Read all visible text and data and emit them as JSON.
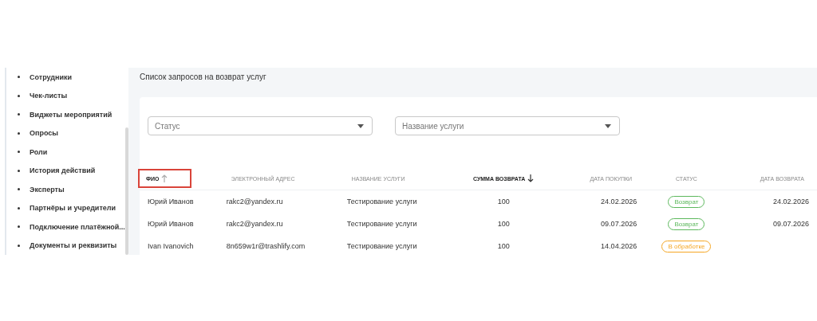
{
  "sidebar": {
    "items": [
      {
        "label": "Сотрудники"
      },
      {
        "label": "Чек-листы"
      },
      {
        "label": "Виджеты мероприятий"
      },
      {
        "label": "Опросы"
      },
      {
        "label": "Роли"
      },
      {
        "label": "История действий"
      },
      {
        "label": "Эксперты"
      },
      {
        "label": "Партнёры и учредители"
      },
      {
        "label": "Подключение платёжной..."
      },
      {
        "label": "Документы и реквизиты"
      }
    ]
  },
  "page_title": "Список запросов на возврат услуг",
  "filters": [
    {
      "placeholder": "Статус"
    },
    {
      "placeholder": "Название услуги"
    }
  ],
  "table": {
    "columns": [
      {
        "label": "ФИО",
        "sorted_ascending": true,
        "sorted_descending": false,
        "highlighted": true
      },
      {
        "label": "ЭЛЕКТРОННЫЙ АДРЕС",
        "sorted_ascending": false,
        "sorted_descending": false,
        "highlighted": false
      },
      {
        "label": "НАЗВАНИЕ УСЛУГИ",
        "sorted_ascending": false,
        "sorted_descending": false,
        "highlighted": false
      },
      {
        "label": "СУММА ВОЗВРАТА",
        "sorted_ascending": false,
        "sorted_descending": true,
        "highlighted": false
      },
      {
        "label": "ДАТА ПОКУПКИ",
        "sorted_ascending": false,
        "sorted_descending": false,
        "highlighted": false
      },
      {
        "label": "СТАТУС",
        "sorted_ascending": false,
        "sorted_descending": false,
        "highlighted": false
      },
      {
        "label": "ДАТА ВОЗВРАТА",
        "sorted_ascending": false,
        "sorted_descending": false,
        "highlighted": false
      }
    ],
    "rows": [
      {
        "name": "Юрий Иванов",
        "email": "rakc2@yandex.ru",
        "service": "Тестирование услуги",
        "amount": "100",
        "purchase_date": "24.02.2026",
        "status": {
          "label": "Возврат",
          "color": "#5cb85c"
        },
        "refund_date": "24.02.2026"
      },
      {
        "name": "Юрий Иванов",
        "email": "rakc2@yandex.ru",
        "service": "Тестирование услуги",
        "amount": "100",
        "purchase_date": "09.07.2026",
        "status": {
          "label": "Возврат",
          "color": "#5cb85c"
        },
        "refund_date": "09.07.2026"
      },
      {
        "name": "Ivan Ivanovich",
        "email": "8n659w1r@trashlify.com",
        "service": "Тестирование услуги",
        "amount": "100",
        "purchase_date": "14.04.2026",
        "status": {
          "label": "В обработке",
          "color": "#f5a623"
        }
      }
    ]
  }
}
